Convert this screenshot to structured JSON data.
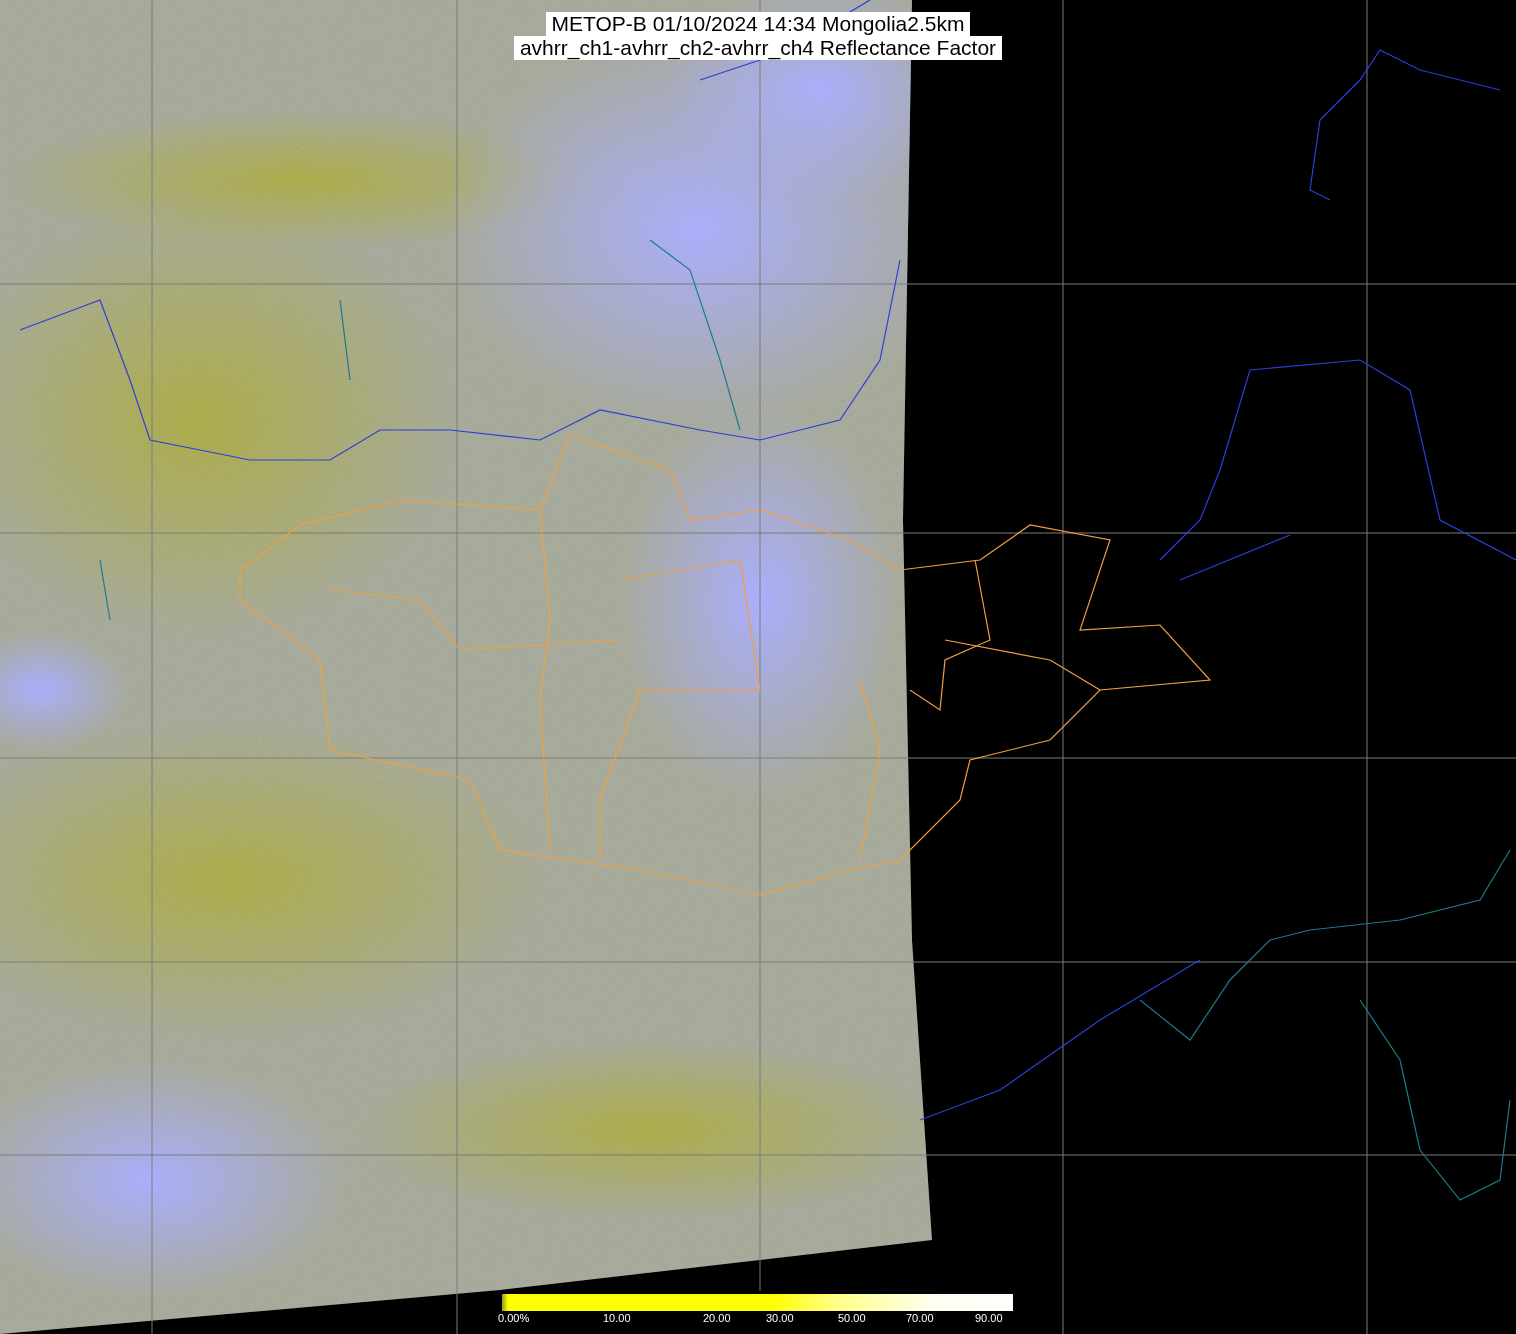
{
  "title": {
    "lines": [
      "METOP-B 01/10/2024 14:34 Mongolia2.5km",
      "avhrr_ch1-avhrr_ch2-avhrr_ch4 Reflectance Factor"
    ]
  },
  "colorbar": {
    "labels": [
      "0.00%",
      "10.00",
      "20.00",
      "30.00",
      "50.00",
      "70.00",
      "90.00"
    ]
  }
}
